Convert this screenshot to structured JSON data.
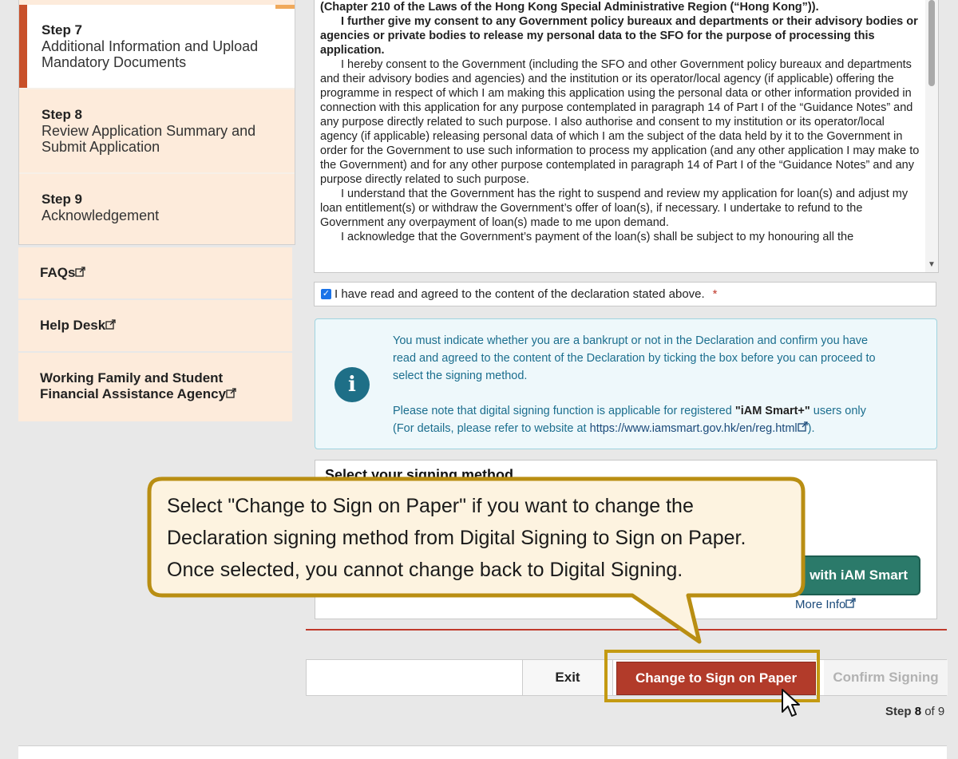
{
  "sidebar": {
    "steps": [
      {
        "num": "Step 7",
        "label_line1": "Additional Information and Upload",
        "label_line2": "Mandatory Documents"
      },
      {
        "num": "Step 8",
        "label_line1": "Review Application Summary and",
        "label_line2": "Submit Application"
      },
      {
        "num": "Step 9",
        "label_line1": "Acknowledgement",
        "label_line2": ""
      }
    ],
    "links": {
      "faqs": "FAQs",
      "help_desk": "Help Desk",
      "agency_line1": "Working Family and Student",
      "agency_line2": "Financial Assistance Agency"
    }
  },
  "declaration": {
    "p0": "(Chapter 210 of the Laws of the Hong Kong Special Administrative Region (“Hong Kong”)).",
    "p1": "I further give my consent to any Government policy bureaux and departments or their advisory bodies or agencies or private bodies to release my personal data to the SFO for the purpose of processing this application.",
    "p2": "I hereby consent to the Government (including the SFO and other Government policy bureaux and departments and their advisory bodies and agencies) and the institution or its operator/local agency (if applicable) offering the programme in respect of which I am making this application using the personal data or other information provided in connection with this application for any purpose contemplated in paragraph 14 of Part I of the “Guidance Notes” and any purpose directly related to such purpose. I also authorise and consent to my institution or its operator/local agency (if applicable) releasing personal data of which I am the subject of the data held by it to the Government in order for the Government to use such information to process my application (and any other application I may make to the Government) and for any other purpose contemplated in paragraph 14 of Part I of the “Guidance Notes” and any purpose directly related to such purpose.",
    "p3": "I understand that the Government has the right to suspend and review my application for loan(s) and adjust my loan entitlement(s) or withdraw the Government’s offer of loan(s), if necessary. I undertake to refund to the Government any overpayment of loan(s) made to me upon demand.",
    "p4": "I acknowledge that the Government’s payment of the loan(s) shall be subject to my honouring all the"
  },
  "agreement": {
    "label": "I have read and agreed to the content of the declaration stated above.",
    "required_mark": "*",
    "checked": true
  },
  "info": {
    "line1": "You must indicate whether you are a bankrupt or not in the Declaration and confirm you have",
    "line2": "read and agreed to the content of the Declaration by ticking the box before you can proceed to",
    "line3": "select the signing method.",
    "note_prefix": "Please note that digital signing function is applicable for registered ",
    "note_strong": "\"iAM Smart+\"",
    "note_suffix": " users only",
    "details_prefix": "(For details, please refer to website at ",
    "details_url": "https://www.iamsmart.gov.hk/en/reg.html",
    "details_suffix": ")."
  },
  "signing": {
    "title": "Select your signing method",
    "iam_button": "with iAM Smart",
    "more_info": "More Info"
  },
  "actions": {
    "exit": "Exit",
    "change_to_paper": "Change to Sign on Paper",
    "confirm": "Confirm Signing"
  },
  "step_indicator": {
    "prefix": "Step ",
    "current": "8",
    "of": " of ",
    "total": "9"
  },
  "callout": {
    "line1": "Select \"Change to Sign on Paper\" if you want to change the",
    "line2": "Declaration signing method from Digital Signing to Sign on Paper.",
    "line3": "Once selected, you cannot change back to Digital Signing."
  },
  "colors": {
    "active_step_bar": "#c8502a",
    "primary_button": "#b23b2a",
    "iam_button": "#2b7a6a",
    "highlight": "#c49a12",
    "info_text": "#1b6e8e"
  }
}
